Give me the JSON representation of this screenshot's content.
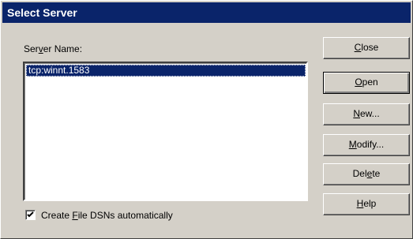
{
  "window": {
    "title": "Select Server"
  },
  "server_name_label": {
    "pre": "Ser",
    "key": "v",
    "post": "er Name:"
  },
  "server_list": {
    "items": [
      "tcp:winnt.1583"
    ],
    "selected_index": 0
  },
  "buttons": {
    "close": {
      "pre": "",
      "key": "C",
      "post": "lose"
    },
    "open": {
      "pre": "",
      "key": "O",
      "post": "pen"
    },
    "new": {
      "pre": "",
      "key": "N",
      "post": "ew..."
    },
    "modify": {
      "pre": "",
      "key": "M",
      "post": "odify..."
    },
    "delete": {
      "pre": "Del",
      "key": "e",
      "post": "te"
    },
    "help": {
      "pre": "",
      "key": "H",
      "post": "elp"
    }
  },
  "create_dsn_checkbox": {
    "checked": true,
    "pre": "Create ",
    "key": "F",
    "post": "ile DSNs automatically"
  },
  "colors": {
    "title_bar": "#0a246a",
    "face": "#d4d0c8",
    "selection": "#0a246a"
  }
}
